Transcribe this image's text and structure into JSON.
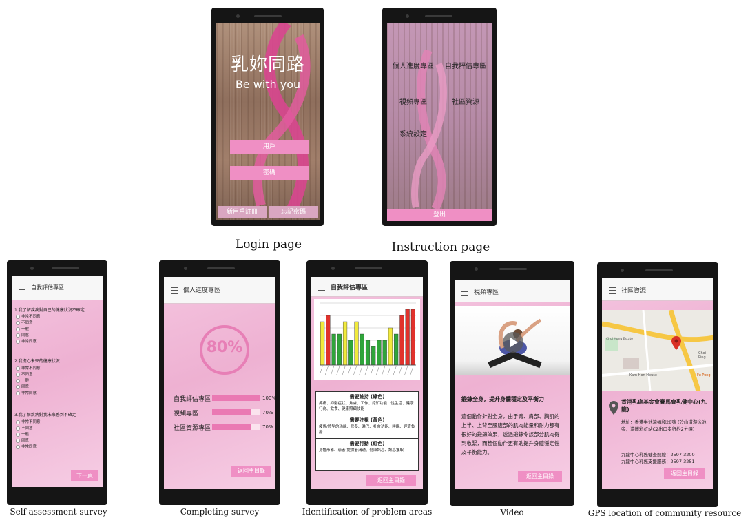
{
  "captions": {
    "login": "Login page",
    "instruction": "Instruction page",
    "survey": "Self-assessment survey",
    "completing": "Completing survey",
    "problem": "Identification of problem areas",
    "video": "Video",
    "gps": "GPS location of community resource"
  },
  "login": {
    "title": "乳妳同路",
    "subtitle": "Be with you",
    "username_label": "用戶",
    "password_label": "密碼",
    "register_label": "新用戶註冊",
    "forgot_label": "忘記密碼"
  },
  "instruction": {
    "menu": [
      "個人進度專區",
      "自我評估專區",
      "視頻專區",
      "社區資源",
      "系統設定"
    ],
    "logout_label": "登出"
  },
  "survey": {
    "header": "自我評估專區",
    "questions": [
      {
        "q": "1.我了解疾病對自己的健康狀況不確定",
        "options": [
          "非常不同意",
          "不同意",
          "一般",
          "同意",
          "非常同意"
        ]
      },
      {
        "q": "2.我擔心未來的健康狀況",
        "options": [
          "非常不同意",
          "不同意",
          "一般",
          "同意",
          "非常同意"
        ]
      },
      {
        "q": "3.我了解疾病對我未來感到不確定",
        "options": [
          "非常不同意",
          "不同意",
          "一般",
          "同意",
          "非常同意"
        ]
      }
    ],
    "next_label": "下一頁"
  },
  "completing": {
    "header": "個人進度專區",
    "percent": "80%",
    "bars": [
      {
        "label": "自我評估專區",
        "value": 1.0,
        "text": "100%"
      },
      {
        "label": "視頻專區",
        "value": 0.7,
        "text": "70%"
      },
      {
        "label": "社區資源專區",
        "value": 0.7,
        "text": "70%"
      }
    ],
    "back_label": "返回主目錄"
  },
  "problem": {
    "header": "自我評估專區",
    "chart_data": {
      "type": "bar",
      "values": [
        7,
        8,
        5,
        5,
        7,
        4,
        7,
        5,
        4,
        3,
        4,
        4,
        6,
        5,
        8,
        9,
        9
      ],
      "colors": [
        "#f1ea3c",
        "#e1322c",
        "#2fa53a",
        "#2fa53a",
        "#f1ea3c",
        "#2fa53a",
        "#f1ea3c",
        "#2fa53a",
        "#2fa53a",
        "#2fa53a",
        "#2fa53a",
        "#2fa53a",
        "#f1ea3c",
        "#2fa53a",
        "#e1322c",
        "#e1322c",
        "#e1322c"
      ],
      "ylim": [
        0,
        10
      ]
    },
    "legend": [
      {
        "head": "需要維持 (綠色)",
        "text": "疼痛、抑鬱症狀、焦慮、工作、認知功能、性生活、健康行為、飲食、健康照顧技能"
      },
      {
        "head": "需要注視 (黃色)",
        "text": "疲倦/體型的功能、營養、淋巴、社會功能、睡眠、經濟負擔"
      },
      {
        "head": "需要行動 (紅色)",
        "text": "身體形象、患者-提供者溝通、健康訊息、訊息獲取"
      }
    ],
    "back_label": "返回主目錄"
  },
  "video": {
    "header": "視頻專區",
    "title": "鍛鍊全身，提升身體穩定及平衡力",
    "body": "這個動作針對全身，由手臂、肩部、胸肌的上半、上背至腰腹部的肌肉能量和耐力都有很好的鍛鍊效果，透過鍛鍊令該部分肌肉得到收緊，而整個動作更有助提升身體穩定性及平衡能力。",
    "back_label": "返回主目錄"
  },
  "gps": {
    "header": "社區資源",
    "place_name": "香港乳癌基金會賽馬會乳健中心(九龍)",
    "address": "地址：香港牛池灣福和28號 (於山道游泳池旁，港鐵彩虹站C2出口步行約2分鐘)",
    "phone1": "九龍中心乳癌健查熱線：2597 3200",
    "phone2": "九龍中心乳癌支援服務：2597 3251",
    "map_label_1": "Choi Hung Estate",
    "map_label_2": "Kam Hon House",
    "map_label_3": "Choi Ping",
    "map_label_4": "Fu Pong",
    "back_label": "返回主目錄"
  }
}
